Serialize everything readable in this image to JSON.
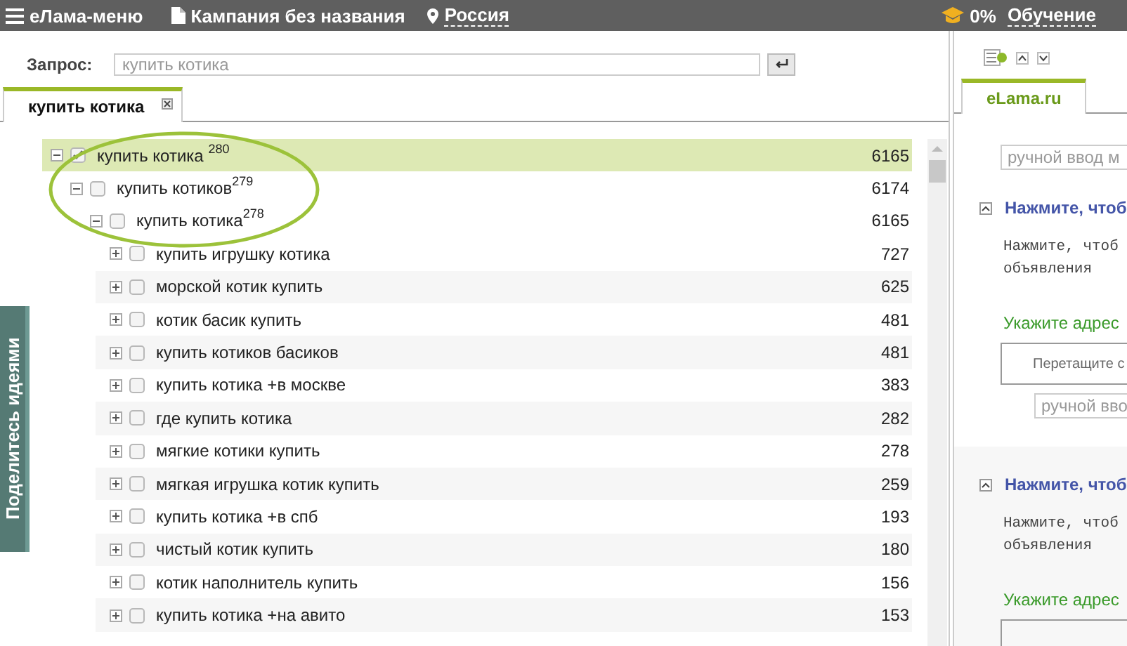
{
  "top_bar": {
    "menu": "eЛама-меню",
    "campaign": "Кампания без названия",
    "region": "Россия",
    "progress": "0%",
    "learning": "Обучение"
  },
  "query": {
    "label": "Запрос:",
    "placeholder": "купить котика"
  },
  "tabs": [
    {
      "label": "купить котика",
      "selected": true
    }
  ],
  "tree": [
    {
      "text": "купить котика $^{280}$",
      "count": "6165",
      "checked": true,
      "selected": true,
      "expanded": true,
      "children": [
        {
          "text": "купить котиков$^{279}$",
          "count": "6174",
          "checked": false,
          "selected": false,
          "expanded": true,
          "children": [
            {
              "text": "купить котика$^{278}$",
              "count": "6165",
              "checked": false,
              "selected": false,
              "expanded": true,
              "children": [
                {
                  "text": "купить игрушку котика",
                  "count": "727",
                  "checked": false,
                  "selected": false,
                  "expanded": false
                },
                {
                  "text": "морской котик купить",
                  "count": "625",
                  "checked": false,
                  "selected": false,
                  "expanded": false
                },
                {
                  "text": "котик басик купить",
                  "count": "481",
                  "checked": false,
                  "selected": false,
                  "expanded": false
                },
                {
                  "text": "купить котиков басиков",
                  "count": "481",
                  "checked": false,
                  "selected": false,
                  "expanded": false
                },
                {
                  "text": "купить котика +в москве",
                  "count": "383",
                  "checked": false,
                  "selected": false,
                  "expanded": false
                },
                {
                  "text": "где купить котика",
                  "count": "282",
                  "checked": false,
                  "selected": false,
                  "expanded": false
                },
                {
                  "text": "мягкие котики купить",
                  "count": "278",
                  "checked": false,
                  "selected": false,
                  "expanded": false
                },
                {
                  "text": "мягкая игрушка котик купить",
                  "count": "259",
                  "checked": false,
                  "selected": false,
                  "expanded": false
                },
                {
                  "text": "купить котика +в спб",
                  "count": "193",
                  "checked": false,
                  "selected": false,
                  "expanded": false
                },
                {
                  "text": "чистый котик купить",
                  "count": "180",
                  "checked": false,
                  "selected": false,
                  "expanded": false
                },
                {
                  "text": "котик наполнитель купить",
                  "count": "156",
                  "checked": false,
                  "selected": false,
                  "expanded": false
                },
                {
                  "text": "купить котика +на авито",
                  "count": "153",
                  "checked": false,
                  "selected": false,
                  "expanded": false
                }
              ]
            }
          ]
        }
      ]
    }
  ],
  "side_tab": "Поделитесь идеями",
  "right_panel": {
    "tabs": [
      {
        "label": "eLama.ru",
        "selected": true
      }
    ],
    "input_placeholder": "ручной ввод м",
    "ads": [
      {
        "header": "Нажмите, чтоб",
        "body": [
          "Нажмите, чтоб",
          "объявления"
        ],
        "url_label": "Укажите адрес",
        "drop_hint": "Перетащите с",
        "input_placeholder": "ручной вво"
      },
      {
        "header": "Нажмите, чтоб",
        "body": [
          "Нажмите, чтоб",
          "объявления"
        ],
        "url_label": "Укажите адрес"
      }
    ]
  }
}
